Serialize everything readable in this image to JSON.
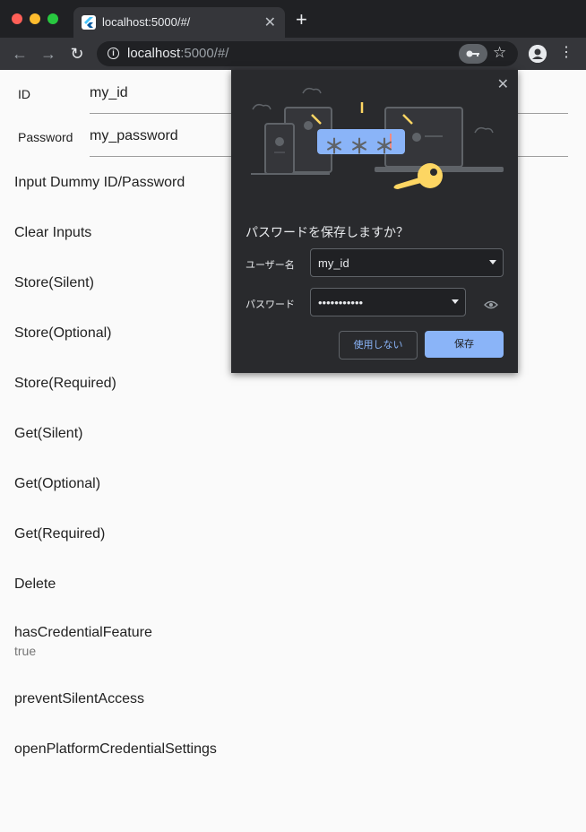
{
  "browser": {
    "tab_title": "localhost:5000/#/",
    "tab_close": "✕",
    "new_tab": "+",
    "url_host": "localhost",
    "url_rest": ":5000/#/",
    "icons": {
      "back": "←",
      "forward": "→",
      "reload": "↻",
      "key": "🔑",
      "star": "☆",
      "menu": "⋮",
      "info": "i"
    }
  },
  "form": {
    "id_label": "ID",
    "id_value": "my_id",
    "password_label": "Password",
    "password_value": "my_password"
  },
  "actions": [
    "Input Dummy ID/Password",
    "Clear Inputs",
    "Store(Silent)",
    "Store(Optional)",
    "Store(Required)",
    "Get(Silent)",
    "Get(Optional)",
    "Get(Required)",
    "Delete",
    "hasCredentialFeature",
    "preventSilentAccess",
    "openPlatformCredentialSettings"
  ],
  "has_credential_feature_value": "true",
  "save_password_popup": {
    "close": "✕",
    "title": "パスワードを保存しますか？",
    "username_label": "ユーザー名",
    "username_value": "my_id",
    "password_label": "パスワード",
    "password_value": "•••••••••••",
    "cancel_button": "使用しない",
    "save_button": "保存",
    "illustration_text": "＊＊＊",
    "colors": {
      "bg": "#292a2d",
      "accent": "#8ab4f8",
      "key": "#fdd663"
    }
  }
}
